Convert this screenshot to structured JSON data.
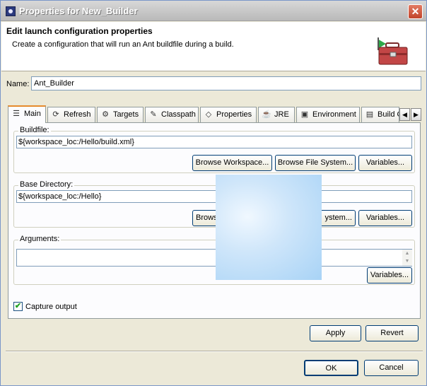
{
  "window": {
    "title": "Properties for New_Builder",
    "close_glyph": "✕"
  },
  "header": {
    "title": "Edit launch configuration properties",
    "description": "Create a configuration that will run an Ant buildfile during a build.",
    "icon": "toolbox-icon"
  },
  "name": {
    "label": "Name:",
    "value": "Ant_Builder"
  },
  "tabs": [
    {
      "label": "Main",
      "icon": "main-icon",
      "active": true
    },
    {
      "label": "Refresh",
      "icon": "refresh-icon"
    },
    {
      "label": "Targets",
      "icon": "targets-icon"
    },
    {
      "label": "Classpath",
      "icon": "classpath-icon"
    },
    {
      "label": "Properties",
      "icon": "properties-icon"
    },
    {
      "label": "JRE",
      "icon": "jre-icon"
    },
    {
      "label": "Environment",
      "icon": "environment-icon"
    },
    {
      "label": "Build O",
      "icon": "build-options-icon"
    }
  ],
  "tab_scroll": {
    "left": "◀",
    "right": "▶"
  },
  "buildfile": {
    "label": "Buildfile:",
    "value": "${workspace_loc:/Hello/build.xml}",
    "browse_workspace": "Browse Workspace...",
    "browse_fs": "Browse File System...",
    "variables": "Variables..."
  },
  "base_directory": {
    "label": "Base Directory:",
    "value": "${workspace_loc:/Hello}",
    "browse_workspace_visible": "Brows",
    "browse_fs_visible": "ystem...",
    "variables": "Variables..."
  },
  "arguments": {
    "label": "Arguments:",
    "value": "",
    "variables": "Variables..."
  },
  "capture_output": {
    "label": "Capture output",
    "checked": true,
    "mark": "✔"
  },
  "buttons": {
    "apply": "Apply",
    "revert": "Revert",
    "ok": "OK",
    "cancel": "Cancel"
  },
  "scroll_arrows": {
    "up": "▲",
    "down": "▼"
  }
}
